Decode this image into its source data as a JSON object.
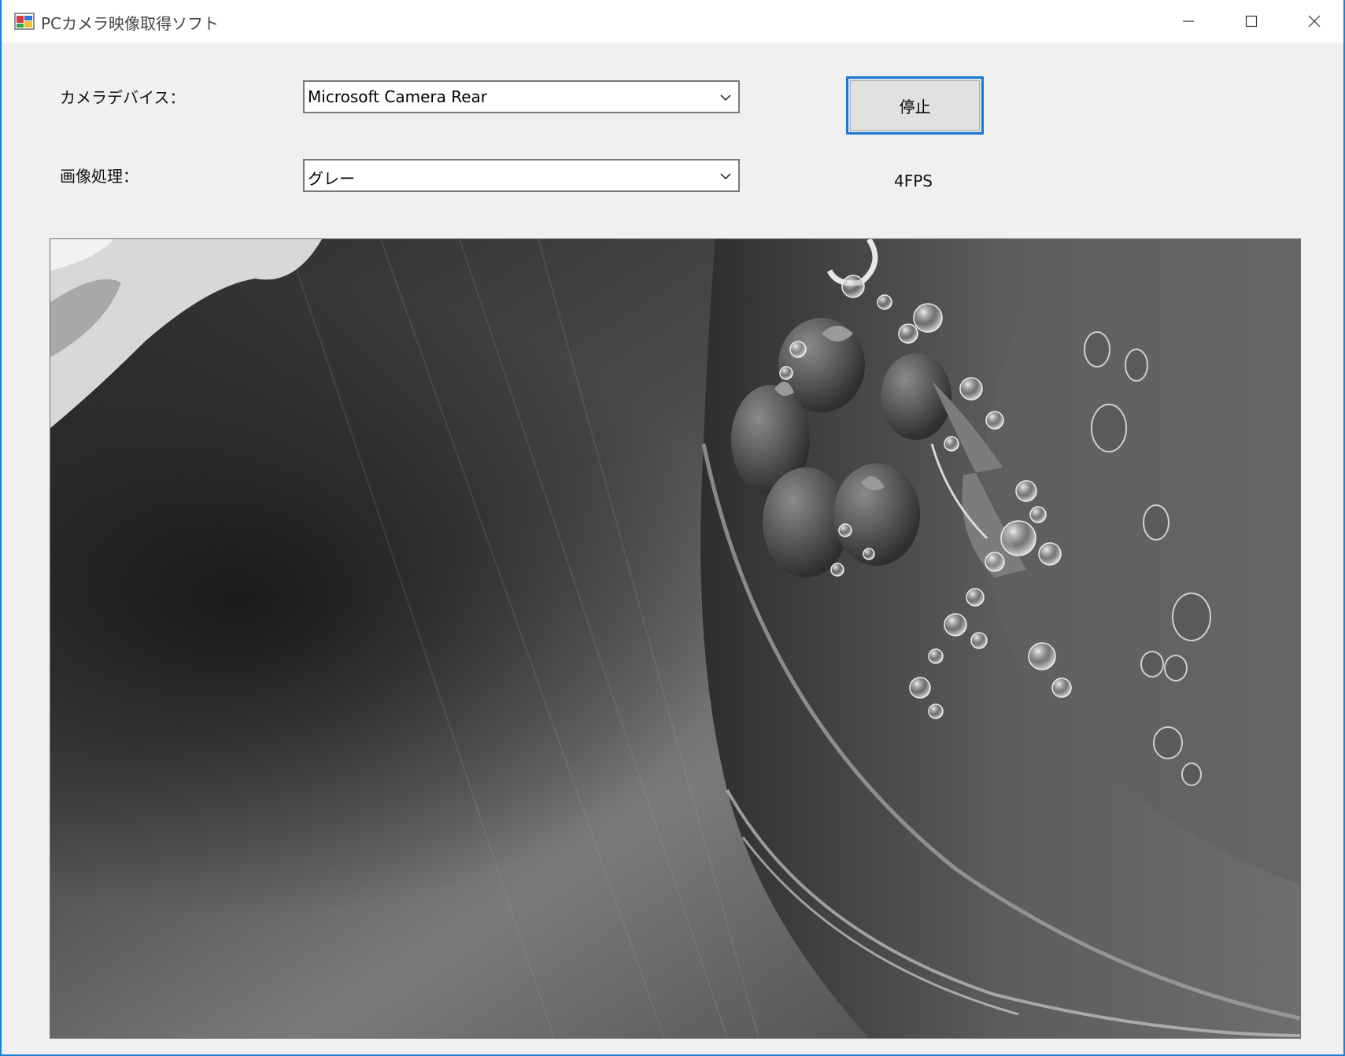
{
  "window": {
    "title": "PCカメラ映像取得ソフト",
    "minimize_glyph": "minimize-icon",
    "maximize_glyph": "maximize-icon",
    "close_glyph": "close-icon"
  },
  "form": {
    "camera_label": "カメラデバイス：",
    "camera_value": "Microsoft Camera Rear",
    "processing_label": "画像処理：",
    "processing_value": "グレー",
    "stop_button": "停止",
    "fps": "4FPS"
  },
  "preview": {
    "mode": "grayscale"
  },
  "colors": {
    "accent": "#1b78d4",
    "window_border": "#1f7fd1",
    "form_background": "#f0f0f0"
  }
}
